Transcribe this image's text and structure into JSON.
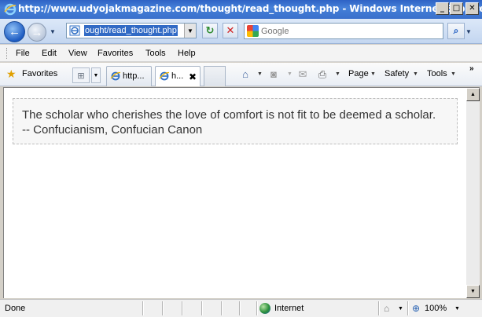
{
  "window": {
    "title": "http://www.udyojakmagazine.com/thought/read_thought.php - Windows Internet Explorer",
    "buttons": {
      "minimize": "_",
      "maximize": "□",
      "close": "✕"
    }
  },
  "navigation": {
    "back_label": "←",
    "forward_label": "→",
    "address": "ought/read_thought.php",
    "search_placeholder": "Google",
    "refresh_glyph": "↻",
    "stop_glyph": "✕",
    "search_go_glyph": "⌕"
  },
  "menubar": {
    "items": [
      "File",
      "Edit",
      "View",
      "Favorites",
      "Tools",
      "Help"
    ]
  },
  "commandbar": {
    "favorites_label": "Favorites",
    "tabs": [
      {
        "label": "http...",
        "active": false
      },
      {
        "label": "h...",
        "active": true
      }
    ],
    "tab_close": "✖",
    "page_label": "Page",
    "safety_label": "Safety",
    "tools_label": "Tools",
    "chevrons": "»"
  },
  "page": {
    "quote": "The scholar who cherishes the love of comfort is not fit to be deemed a scholar.",
    "source": "-- Confucianism, Confucian Canon"
  },
  "statusbar": {
    "status": "Done",
    "zone": "Internet",
    "zoom": "100%"
  },
  "icons": {
    "ie": "ie-logo-icon",
    "favorites": "star-icon",
    "home": "home-icon",
    "feeds": "rss-icon",
    "mail": "mail-icon",
    "print": "printer-icon",
    "zone": "globe-icon",
    "zoom": "magnifier-icon"
  },
  "colors": {
    "titlebar": "#2e62c5",
    "address_highlight": "#316ac5",
    "quote_text": "#333333",
    "quote_border": "#bdbdbd"
  }
}
